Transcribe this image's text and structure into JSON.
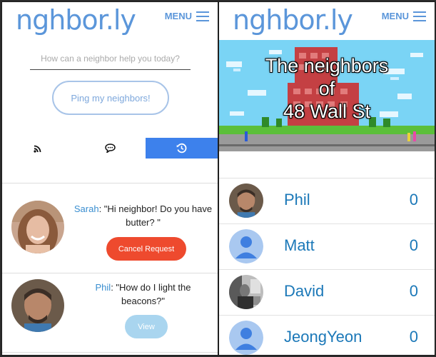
{
  "app": {
    "logo": "nghbor.ly",
    "menu_label": "MENU"
  },
  "request_screen": {
    "ask_placeholder": "How can a neighbor help you today?",
    "ping_button": "Ping my neighbors!",
    "tabs": [
      {
        "icon": "rss-icon",
        "active": false
      },
      {
        "icon": "chat-bubble-icon",
        "active": false
      },
      {
        "icon": "history-icon",
        "active": true
      }
    ],
    "requests": [
      {
        "name": "Sarah",
        "message": "\"Hi neighbor! Do you have butter? \"",
        "button": "Cancel Request"
      },
      {
        "name": "Phil",
        "message": "\"How do I light the beacons?\"",
        "button": "View"
      }
    ]
  },
  "neighbors_screen": {
    "banner_lines": [
      "The neighbors",
      "of",
      "48 Wall St"
    ],
    "neighbors": [
      {
        "name": "Phil",
        "count": "0",
        "avatar": "photo"
      },
      {
        "name": "Matt",
        "count": "0",
        "avatar": "default-user-icon"
      },
      {
        "name": "David",
        "count": "0",
        "avatar": "photo"
      },
      {
        "name": "JeongYeon",
        "count": "0",
        "avatar": "default-user-icon"
      }
    ]
  },
  "colors": {
    "brand_blue": "#5b96da",
    "active_tab": "#3d81ec",
    "cancel_red": "#ee4a2e",
    "view_blue": "#a9d5ef",
    "name_blue": "#1b78b8"
  }
}
